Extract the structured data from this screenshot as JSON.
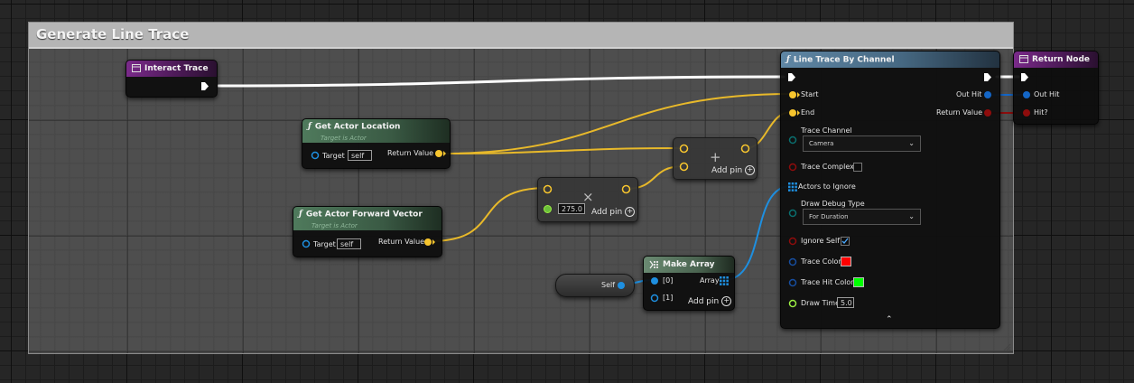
{
  "comment": {
    "title": "Generate Line Trace"
  },
  "colors": {
    "exec": "#ffffff",
    "vector": "#f7c52e",
    "object": "#1e8fe0",
    "struct": "#0f5fb8",
    "bool": "#8e0c0c",
    "float": "#9cef43",
    "byte": "#0a6f6f",
    "linear_color": "#174ea0"
  },
  "interact_trace": {
    "title": "Interact Trace"
  },
  "get_actor_location": {
    "title": "Get Actor Location",
    "subtitle": "Target is Actor",
    "target_label": "Target",
    "target_value": "self",
    "return_label": "Return Value"
  },
  "get_actor_forward_vector": {
    "title": "Get Actor Forward Vector",
    "subtitle": "Target is Actor",
    "target_label": "Target",
    "target_value": "self",
    "return_label": "Return Value"
  },
  "multiply_node": {
    "op_symbol": "×",
    "value": "275.0",
    "add_pin_label": "Add pin"
  },
  "add_node": {
    "op_symbol": "+",
    "add_pin_label": "Add pin"
  },
  "self_node": {
    "label": "Self"
  },
  "make_array": {
    "title": "Make Array",
    "pin0": "[0]",
    "pin1": "[1]",
    "array_label": "Array",
    "add_pin_label": "Add pin"
  },
  "line_trace": {
    "title": "Line Trace By Channel",
    "start": "Start",
    "end": "End",
    "trace_channel_label": "Trace Channel",
    "trace_channel_value": "Camera",
    "trace_complex": "Trace Complex",
    "actors_to_ignore": "Actors to Ignore",
    "draw_debug_type_label": "Draw Debug Type",
    "draw_debug_type_value": "For Duration",
    "ignore_self": "Ignore Self",
    "trace_color": "Trace Color",
    "trace_color_value": "#ff0000",
    "trace_hit_color": "Trace Hit Color",
    "trace_hit_color_value": "#00ff00",
    "draw_time": "Draw Time",
    "draw_time_value": "5.0",
    "out_hit": "Out Hit",
    "return_value": "Return Value"
  },
  "return_node": {
    "title": "Return Node",
    "out_hit": "Out Hit",
    "hit": "Hit?"
  }
}
